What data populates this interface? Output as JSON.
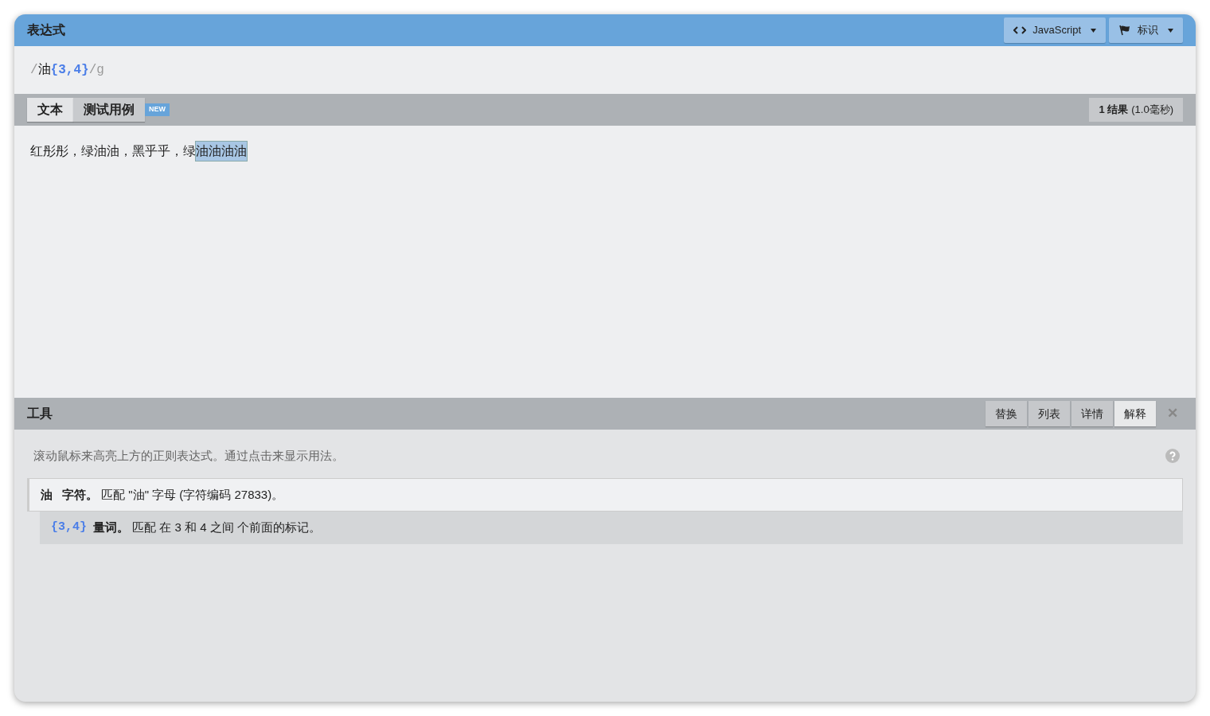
{
  "expression": {
    "title": "表达式",
    "buttons": [
      {
        "label": "JavaScript",
        "kind": "code"
      },
      {
        "label": "标识",
        "kind": "flag"
      }
    ],
    "pattern": [
      {
        "text": "/",
        "kind": "delim"
      },
      {
        "text": "油",
        "kind": "char"
      },
      {
        "text": "{3,4}",
        "kind": "quant"
      },
      {
        "text": "/g",
        "kind": "flags"
      }
    ]
  },
  "text_panel": {
    "tabs": [
      {
        "label": "文本",
        "selected": true
      },
      {
        "label": "测试用例",
        "selected": false,
        "badge": "NEW"
      }
    ],
    "result_count": "1 结果",
    "result_time": "(1.0毫秒)",
    "segments": [
      {
        "text": "红彤彤，绿油油，黑乎乎，绿",
        "match": false
      },
      {
        "text": "油油油油",
        "match": true
      }
    ]
  },
  "tools": {
    "title": "工具",
    "tabs": [
      {
        "label": "替换",
        "selected": false
      },
      {
        "label": "列表",
        "selected": false
      },
      {
        "label": "详情",
        "selected": false
      },
      {
        "label": "解释",
        "selected": true
      }
    ],
    "close": "✕",
    "hint": "滚动鼠标来高亮上方的正则表达式。通过点击来显示用法。",
    "explanation": [
      {
        "token": "油",
        "kind": "char",
        "label": "字符。",
        "desc": "匹配 \"油\" 字母 (字符编码 27833)。",
        "children": [
          {
            "token": "{3,4}",
            "kind": "quant",
            "label": "量词。",
            "desc": "匹配 在 3 和 4 之间 个前面的标记。"
          }
        ]
      }
    ]
  }
}
